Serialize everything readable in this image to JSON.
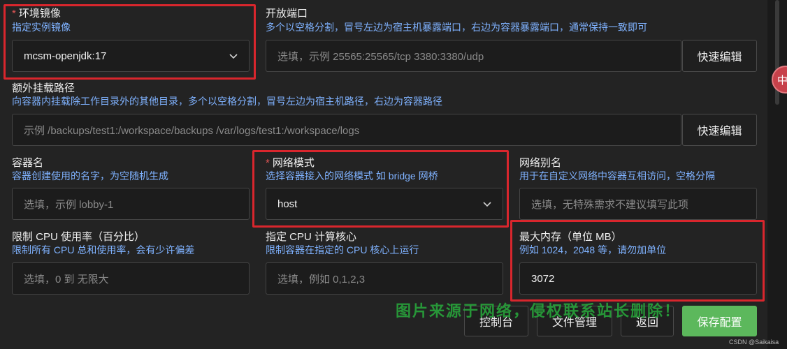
{
  "form": {
    "image": {
      "required_mark": "*",
      "label": "环境镜像",
      "hint": "指定实例镜像",
      "value": "mcsm-openjdk:17"
    },
    "ports": {
      "label": "开放端口",
      "hint": "多个以空格分割，冒号左边为宿主机暴露端口，右边为容器暴露端口，通常保持一致即可",
      "placeholder": "选填，示例 25565:25565/tcp 3380:3380/udp",
      "quick_edit": "快速编辑"
    },
    "mounts": {
      "label": "额外挂载路径",
      "hint": "向容器内挂载除工作目录外的其他目录，多个以空格分割，冒号左边为宿主机路径，右边为容器路径",
      "placeholder": "示例 /backups/test1:/workspace/backups /var/logs/test1:/workspace/logs",
      "quick_edit": "快速编辑"
    },
    "container_name": {
      "label": "容器名",
      "hint": "容器创建使用的名字，为空随机生成",
      "placeholder": "选填，示例 lobby-1"
    },
    "network_mode": {
      "required_mark": "*",
      "label": "网络模式",
      "hint": "选择容器接入的网络模式 如 bridge 网桥",
      "value": "host"
    },
    "network_alias": {
      "label": "网络别名",
      "hint": "用于在自定义网络中容器互相访问，空格分隔",
      "placeholder": "选填，无特殊需求不建议填写此项"
    },
    "cpu_limit": {
      "label": "限制 CPU 使用率（百分比）",
      "hint": "限制所有 CPU 总和使用率，会有少许偏差",
      "placeholder": "选填，0 到 无限大"
    },
    "cpu_cores": {
      "label": "指定 CPU 计算核心",
      "hint": "限制容器在指定的 CPU 核心上运行",
      "placeholder": "选填，例如 0,1,2,3"
    },
    "max_memory": {
      "label": "最大内存（单位 MB）",
      "hint": "例如 1024，2048 等，请勿加单位",
      "value": "3072"
    }
  },
  "actions": {
    "console": "控制台",
    "file_manager": "文件管理",
    "back": "返回",
    "save": "保存配置"
  },
  "overlay": {
    "watermark": "图片来源于网络，侵权联系站长删除！",
    "credit": "CSDN @Saikaisa",
    "float_badge": "中"
  },
  "colors": {
    "background": "#232323",
    "hint_text": "#7fb2ff",
    "primary_button": "#5cb85c",
    "highlight_box": "#d9262d",
    "required_mark": "#e05555"
  }
}
